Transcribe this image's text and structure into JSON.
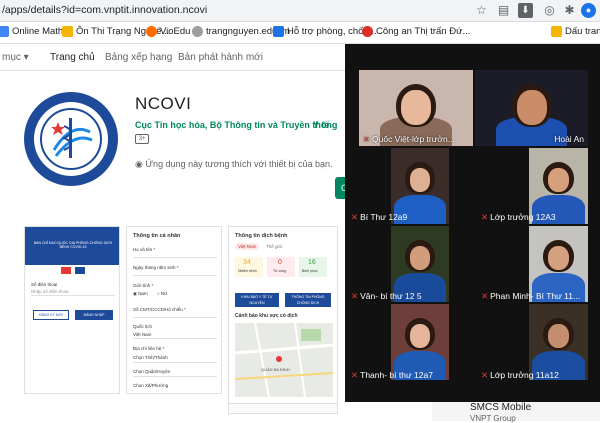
{
  "browser": {
    "url": "/apps/details?id=com.vnptit.innovation.ncovi",
    "bookmarks": [
      {
        "label": "Online Math",
        "icon": "math-icon",
        "color": "#4285f4"
      },
      {
        "label": "Ôn Thi Trạng Nguyê...",
        "icon": "book-icon",
        "color": "#f4b400"
      },
      {
        "label": "VioEdu",
        "icon": "vioedu-icon",
        "color": "#ff6d00"
      },
      {
        "label": "trangnguyen.edu.vn",
        "icon": "globe-icon",
        "color": "#9e9e9e"
      },
      {
        "label": "Hỗ trợ phòng, chốn...",
        "icon": "shield-icon",
        "color": "#1a73e8"
      },
      {
        "label": "Công an Thị trấn Đứ...",
        "icon": "police-icon",
        "color": "#d93025"
      },
      {
        "label": "Dấu trang",
        "icon": "folder-icon",
        "color": "#f4b400"
      }
    ]
  },
  "playstore": {
    "nav": {
      "menu": "mục",
      "home": "Trang chủ",
      "charts": "Bảng xếp hạng",
      "new": "Bản phát hành mới"
    },
    "app": {
      "title": "NCOVI",
      "developer": "Cục Tin học hóa, Bộ Thông tin và Truyền thông",
      "category": "Y tế",
      "rating_badge": "3+",
      "compat": "Ứng dụng này tương thích với thiết bị của bạn.",
      "install": "C"
    },
    "screenshot1": {
      "header": "BAN CHỈ ĐẠO QUỐC GIA PHÒNG CHỐNG DỊCH BỆNH COVID-19",
      "phone_label": "Số điện thoại",
      "phone_placeholder": "Nhập số điện thoại",
      "register": "ĐĂNG KÝ MỚI",
      "login": "ĐĂNG NHẬP"
    },
    "screenshot2": {
      "title": "Thông tin cá nhân",
      "fields": [
        "Họ và tên *",
        "Ngày tháng năm sinh *",
        "Giới tính *",
        "Số CMT/CCCD/Hộ chiếu *",
        "Quốc tịch",
        "Địa chỉ liên hệ *",
        "Chọn Tỉnh/Thành",
        "Chọn Quận/Huyện",
        "Chọn Xã/Phường"
      ],
      "gender": [
        "Nam",
        "Nữ"
      ],
      "country": "Việt Nam"
    },
    "screenshot3": {
      "title": "Thông tin dịch bệnh",
      "tabs": [
        "Việt Nam",
        "Thế giới"
      ],
      "stats": [
        {
          "value": "34",
          "label": "Nhiễm bệnh",
          "color": "#f9a825"
        },
        {
          "value": "0",
          "label": "Tử vong",
          "color": "#e53935"
        },
        {
          "value": "16",
          "label": "Bình phục",
          "color": "#43a047"
        }
      ],
      "btn_left": "KHAI BÁO Y TẾ TỰ NGUYỆN",
      "btn_right": "THÔNG TIN PHÒNG CHỐNG DỊCH",
      "map_title": "Cảnh báo khu vực có dịch",
      "map_label": "QUẬN BA ĐÌNH"
    },
    "related": {
      "name": "SMCS Mobile",
      "sub": "VNPT Group"
    }
  },
  "video_call": {
    "participants": [
      {
        "name": "Quốc Việt-lớp trưởn...",
        "bg": "#c9b7ae",
        "shirt": "#8a6a58",
        "face": "#e7b99a"
      },
      {
        "name": "Hoài An",
        "bg": "#1c1c28",
        "shirt": "#1d4fb0",
        "face": "#c98d6a"
      },
      {
        "name": "Bí Thư 12a9",
        "bg": "#3a2c28",
        "shirt": "#1d5fc2",
        "face": "#e0b095"
      },
      {
        "name": "Lớp trưởng 12A3",
        "bg": "#b9b4a8",
        "shirt": "#2458b8",
        "face": "#d7a07c"
      },
      {
        "name": "Vân- bí thư 12 5",
        "bg": "#2f3a22",
        "shirt": "#1a4a9a",
        "face": "#d19d7c"
      },
      {
        "name": "Phan Minh- Bí Thư 11...",
        "bg": "#c5c3bf",
        "shirt": "#2c64c4",
        "face": "#d5a080"
      },
      {
        "name": "Thanh- bí thư 12a7",
        "bg": "#6e3f3a",
        "shirt": "#1f5ab5",
        "face": "#e4b59b"
      },
      {
        "name": "Lớp trưởng 11a12",
        "bg": "#3b3026",
        "shirt": "#1b4da0",
        "face": "#c48f6e"
      }
    ]
  }
}
